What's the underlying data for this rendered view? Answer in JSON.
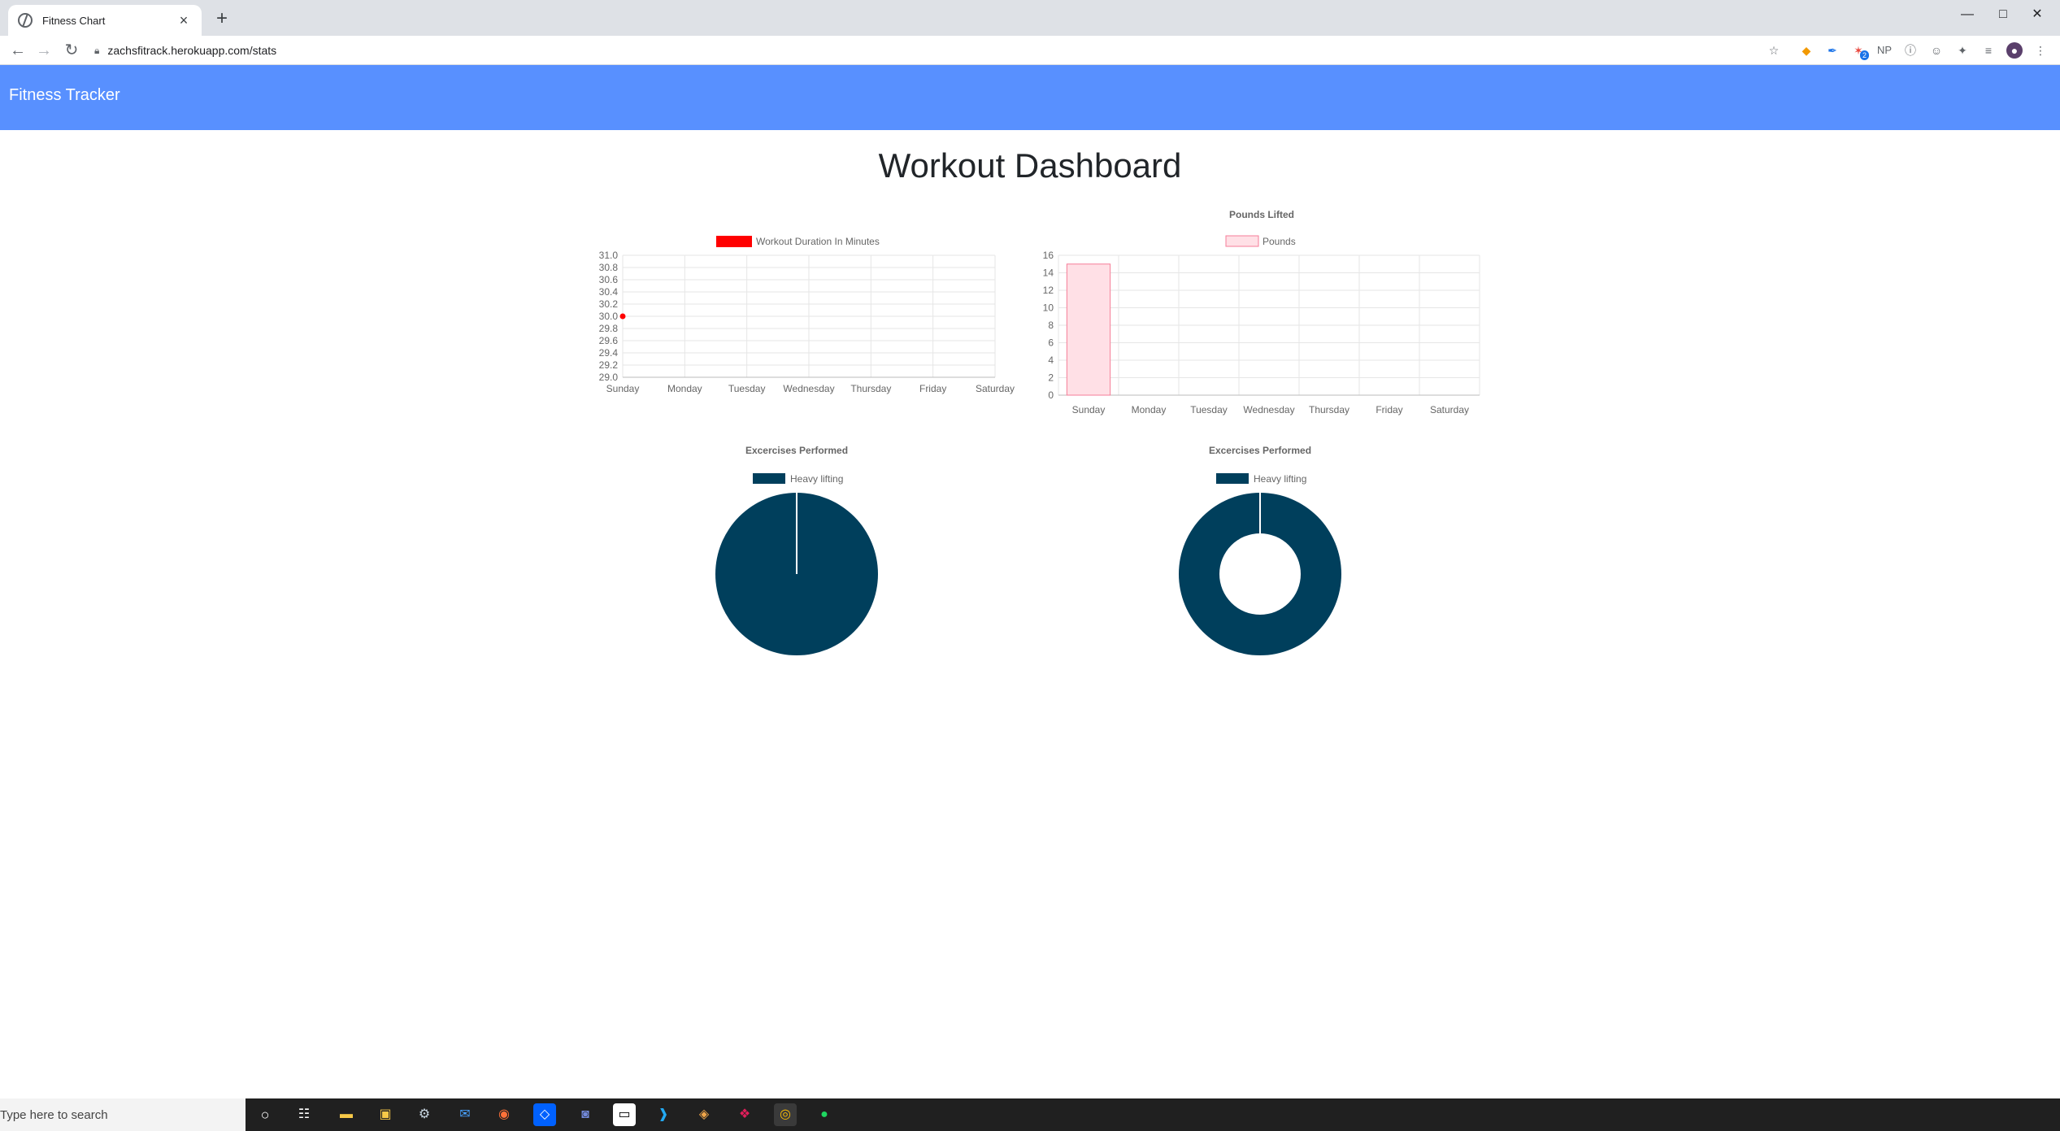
{
  "browser": {
    "tab_title": "Fitness Chart",
    "close_glyph": "×",
    "new_tab_glyph": "+",
    "url": "zachsfitrack.herokuapp.com/stats",
    "ext_np": "NP",
    "ext_badge": "2"
  },
  "navbar": {
    "brand": "Fitness Tracker"
  },
  "page": {
    "title": "Workout Dashboard"
  },
  "charts": {
    "duration": {
      "legend": "Workout Duration In Minutes",
      "color": "#ff0000",
      "categories": [
        "Sunday",
        "Monday",
        "Tuesday",
        "Wednesday",
        "Thursday",
        "Friday",
        "Saturday"
      ],
      "ylim": [
        29.0,
        31.0
      ],
      "yticks": [
        "31.0",
        "30.8",
        "30.6",
        "30.4",
        "30.2",
        "30.0",
        "29.8",
        "29.6",
        "29.4",
        "29.2",
        "29.0"
      ],
      "values": [
        30
      ]
    },
    "pounds": {
      "title": "Pounds Lifted",
      "legend": "Pounds",
      "fill": "#ffe0e6",
      "stroke": "#f57d98",
      "categories": [
        "Sunday",
        "Monday",
        "Tuesday",
        "Wednesday",
        "Thursday",
        "Friday",
        "Saturday"
      ],
      "ylim": [
        0,
        16
      ],
      "yticks": [
        "16",
        "14",
        "12",
        "10",
        "8",
        "6",
        "4",
        "2",
        "0"
      ],
      "values": [
        15
      ]
    },
    "pie": {
      "title": "Excercises Performed",
      "legend": "Heavy lifting",
      "color": "#003f5c"
    },
    "doughnut": {
      "title": "Excercises Performed",
      "legend": "Heavy lifting",
      "color": "#003f5c"
    }
  },
  "taskbar": {
    "search_placeholder": "Type here to search"
  }
}
